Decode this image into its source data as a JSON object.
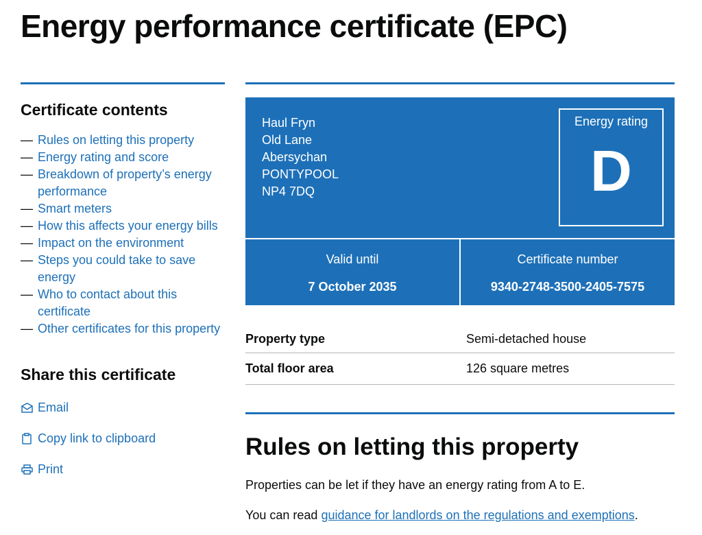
{
  "page": {
    "title": "Energy performance certificate (EPC)"
  },
  "sidebar": {
    "contents_title": "Certificate contents",
    "dash": "—",
    "items": [
      {
        "label": "Rules on letting this property"
      },
      {
        "label": "Energy rating and score"
      },
      {
        "label": "Breakdown of property’s energy performance"
      },
      {
        "label": "Smart meters"
      },
      {
        "label": "How this affects your energy bills"
      },
      {
        "label": "Impact on the environment"
      },
      {
        "label": "Steps you could take to save energy"
      },
      {
        "label": "Who to contact about this certificate"
      },
      {
        "label": "Other certificates for this property"
      }
    ],
    "share_title": "Share this certificate",
    "share": [
      {
        "label": "Email",
        "icon": "envelope-icon"
      },
      {
        "label": "Copy link to clipboard",
        "icon": "clipboard-icon"
      },
      {
        "label": "Print",
        "icon": "printer-icon"
      }
    ]
  },
  "certificate": {
    "address": [
      "Haul Fryn",
      "Old Lane",
      "Abersychan",
      "PONTYPOOL",
      "NP4 7DQ"
    ],
    "rating_label": "Energy rating",
    "rating": "D",
    "valid_label": "Valid until",
    "valid_until": "7 October 2035",
    "number_label": "Certificate number",
    "number": "9340-2748-3500-2405-7575",
    "box_color": "#1d70b8"
  },
  "summary": [
    {
      "key": "Property type",
      "value": "Semi-detached house"
    },
    {
      "key": "Total floor area",
      "value": "126 square metres"
    }
  ],
  "rules": {
    "title": "Rules on letting this property",
    "para1": "Properties can be let if they have an energy rating from A to E.",
    "para2_prefix": "You can read ",
    "para2_link": "guidance for landlords on the regulations and exemptions",
    "para2_suffix": "."
  },
  "colors": {
    "link": "#1d70b8",
    "text": "#0b0c0c",
    "rule": "#b1b4b6"
  }
}
